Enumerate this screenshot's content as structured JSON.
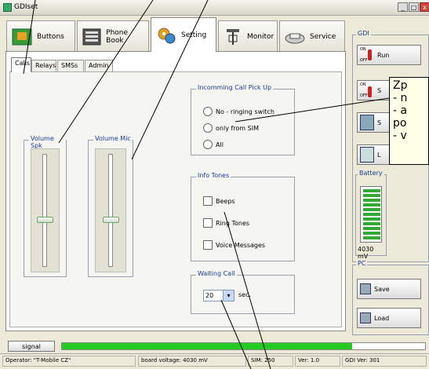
{
  "window": {
    "title": "GDIset",
    "controls": [
      "_",
      "□",
      "x"
    ]
  },
  "tabs": [
    {
      "label": "Buttons",
      "icon": "phone-buttons-icon"
    },
    {
      "label": "Phone Book",
      "icon": "phone-book-icon"
    },
    {
      "label": "Setting",
      "icon": "gears-icon",
      "active": true
    },
    {
      "label": "Monitor",
      "icon": "antenna-icon"
    },
    {
      "label": "Service",
      "icon": "service-icon"
    }
  ],
  "subtabs": [
    {
      "label": "Calls",
      "active": true
    },
    {
      "label": "Relays"
    },
    {
      "label": "SMSs"
    },
    {
      "label": "Admin"
    }
  ],
  "volume_spk": {
    "title": "Volume Spk",
    "level": 0.42
  },
  "volume_mic": {
    "title": "Volume Mic",
    "level": 0.42
  },
  "pickup": {
    "title": "Incomming Call Pick Up",
    "options": [
      "No - ringing switch",
      "only from SIM",
      "All"
    ],
    "selected_index": -1
  },
  "tones": {
    "title": "Info Tones",
    "items": [
      "Beeps",
      "Ring Tones",
      "Voice Messages"
    ]
  },
  "waiting": {
    "title": "Waiting Call",
    "value": "20",
    "unit": "sec."
  },
  "gdi": {
    "title": "GDI",
    "run_label": "Run",
    "on": "ON",
    "off": "OFF",
    "btn2": "S",
    "btn3": "S",
    "btn4": "L"
  },
  "battery": {
    "title": "Battery",
    "voltage": "4030 mV",
    "level": 1.0
  },
  "pc": {
    "title": "PC",
    "save": "Save",
    "load": "Load"
  },
  "signal": {
    "label": "signal",
    "level": 0.8
  },
  "status": {
    "operator": "Operator: \"T-Mobile CZ\"",
    "board": "board voltage: 4030 mV",
    "sim": "SIM: 250",
    "ver": "Ver: 1.0",
    "gdi_ver": "GDI Ver: 301"
  },
  "callout": {
    "lines": [
      "Zp",
      "- n",
      "- a",
      "po",
      "- v"
    ]
  },
  "colors": {
    "accent": "#1a3a8a",
    "signal": "#22cc22",
    "battery": "#33aa33"
  }
}
